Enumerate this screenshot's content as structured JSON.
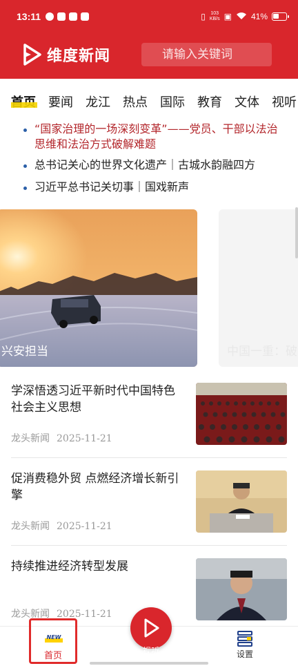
{
  "status_bar": {
    "time": "13:11",
    "net_speed_value": "103",
    "net_speed_unit": "KB/s",
    "battery": "41%"
  },
  "header": {
    "app_name": "维度新闻",
    "search_placeholder": "请输入关键词"
  },
  "tabs": [
    "首页",
    "要闻",
    "龙江",
    "热点",
    "国际",
    "教育",
    "文体",
    "视听"
  ],
  "headlines": [
    {
      "text": "“国家治理的一场深刻变革”——党员、干部以法治思维和法治方式破解难题",
      "highlight": true
    },
    {
      "text": "总书记关心的世界文化遗产｜古城水韵融四方",
      "highlight": false
    },
    {
      "text": "习近平总书记关切事｜国戏新声",
      "highlight": false
    }
  ],
  "carousel": {
    "slides": [
      {
        "caption": "兴安担当"
      },
      {
        "caption": "中国一重：破"
      }
    ]
  },
  "news": [
    {
      "title": "学深悟透习近平新时代中国特色社会主义思想",
      "source": "龙头新闻",
      "date": "2025-11-21"
    },
    {
      "title": "促消费稳外贸 点燃经济增长新引擎",
      "source": "龙头新闻",
      "date": "2025-11-21"
    },
    {
      "title": "持续推进经济转型发展",
      "source": "龙头新闻",
      "date": "2025-11-21"
    }
  ],
  "bottom_nav": {
    "home_badge": "NEW",
    "home_label": "首页",
    "center_label": "视听",
    "settings_label": "设置"
  },
  "colors": {
    "brand_red": "#d9262c",
    "headline_red": "#b3262b",
    "bullet_blue": "#2b5fa8",
    "tab_underline": "#f5d400"
  }
}
